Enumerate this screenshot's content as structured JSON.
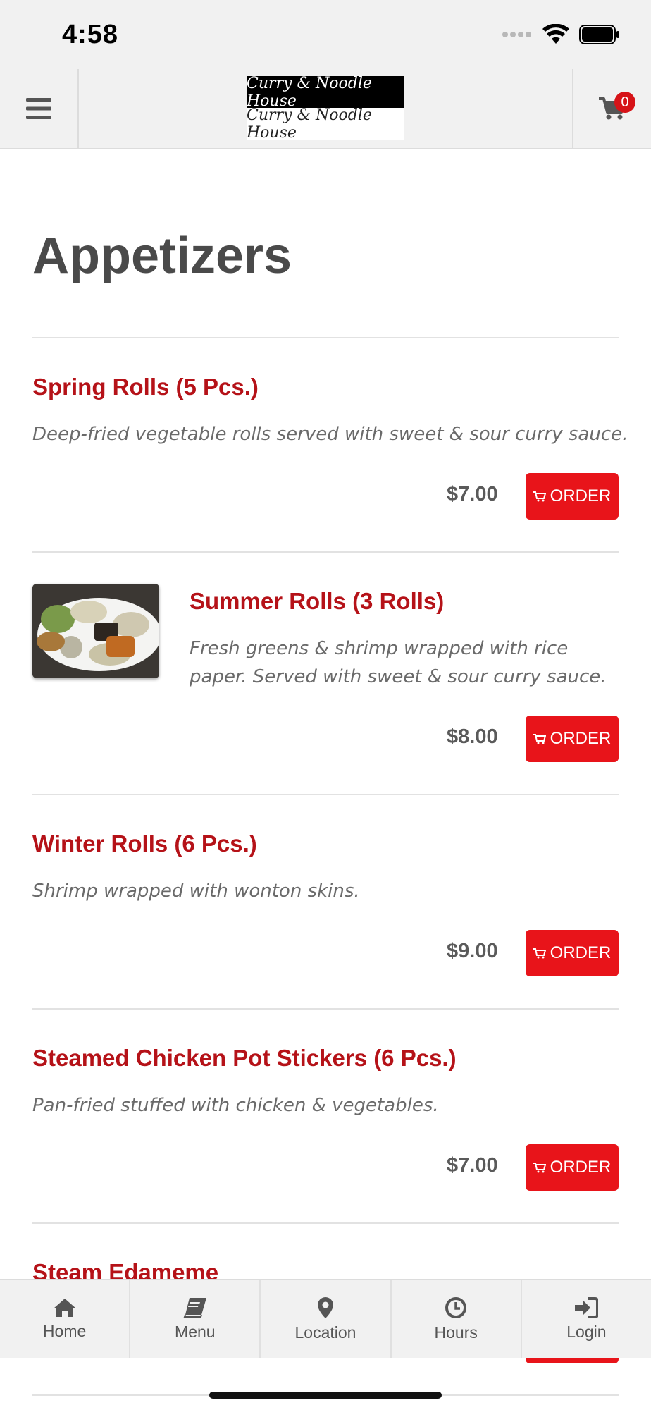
{
  "status_bar": {
    "time": "4:58"
  },
  "header": {
    "logo_line1": "Curry & Noodle House",
    "logo_line2": "Curry & Noodle House",
    "cart_count": "0"
  },
  "page": {
    "title": "Appetizers"
  },
  "items": [
    {
      "name": "Spring Rolls (5 Pcs.)",
      "description": "Deep-fried vegetable rolls served with sweet & sour curry sauce.",
      "price": "$7.00",
      "order_label": "ORDER"
    },
    {
      "name": "Summer Rolls (3 Rolls)",
      "description_line1": "Fresh greens & shrimp wrapped with rice",
      "description_line2": "paper. Served with sweet & sour curry sauce.",
      "price": "$8.00",
      "order_label": "ORDER",
      "image": "summer-rolls-photo"
    },
    {
      "name": "Winter Rolls (6 Pcs.)",
      "description": "Shrimp wrapped with wonton skins.",
      "price": "$9.00",
      "order_label": "ORDER"
    },
    {
      "name": "Steamed Chicken Pot Stickers (6 Pcs.)",
      "description": "Pan-fried stuffed with chicken & vegetables.",
      "price": "$7.00",
      "order_label": "ORDER"
    },
    {
      "name": "Steam Edameme"
    }
  ],
  "tabbar": {
    "tabs": [
      {
        "label": "Home",
        "icon": "home-icon"
      },
      {
        "label": "Menu",
        "icon": "book-icon"
      },
      {
        "label": "Location",
        "icon": "map-pin-icon"
      },
      {
        "label": "Hours",
        "icon": "clock-icon"
      },
      {
        "label": "Login",
        "icon": "sign-in-icon"
      }
    ]
  },
  "colors": {
    "accent": "#e8141a",
    "item_name": "#b51218",
    "chrome": "#f1f1f1"
  }
}
